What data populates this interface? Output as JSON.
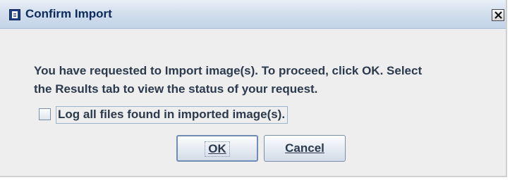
{
  "dialog": {
    "title": "Confirm Import",
    "title_icon": "app-document-icon",
    "close_icon": "close-icon",
    "message_lines": [
      "You have requested to Import image(s). To proceed, click OK. Select",
      "the Results tab to view the status of your request."
    ],
    "checkbox": {
      "label": "Log all files found in imported image(s).",
      "checked": false
    },
    "buttons": {
      "ok_label": "OK",
      "cancel_label": "Cancel"
    }
  }
}
